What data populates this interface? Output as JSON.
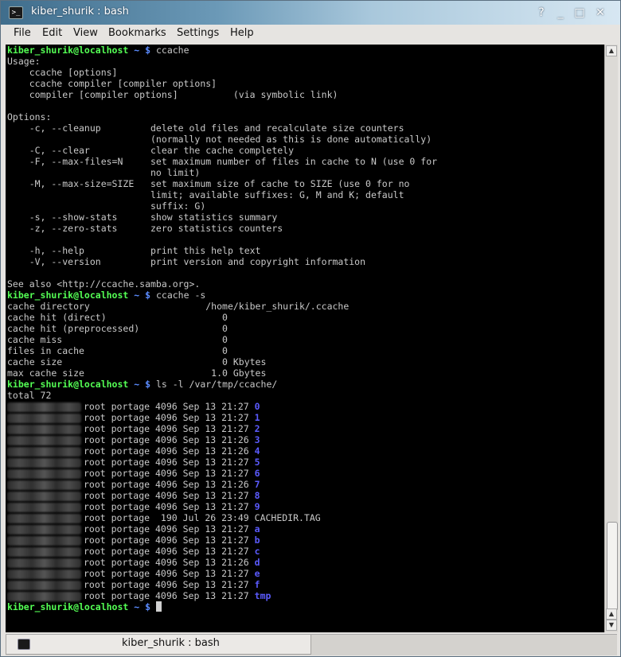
{
  "window": {
    "title": "kiber_shurik : bash"
  },
  "titlebar_buttons": [
    "?",
    "_",
    "□",
    "✕"
  ],
  "menu": [
    "File",
    "Edit",
    "View",
    "Bookmarks",
    "Settings",
    "Help"
  ],
  "prompt": {
    "user": "kiber_shurik@localhost",
    "dir": "~ $"
  },
  "commands": {
    "c1": "ccache",
    "c2": "ccache -s",
    "c3": "ls -l /var/tmp/ccache/"
  },
  "help_lines": [
    "Usage:",
    "    ccache [options]",
    "    ccache compiler [compiler options]",
    "    compiler [compiler options]          (via symbolic link)",
    "",
    "Options:",
    "    -c, --cleanup         delete old files and recalculate size counters",
    "                          (normally not needed as this is done automatically)",
    "    -C, --clear           clear the cache completely",
    "    -F, --max-files=N     set maximum number of files in cache to N (use 0 for",
    "                          no limit)",
    "    -M, --max-size=SIZE   set maximum size of cache to SIZE (use 0 for no",
    "                          limit; available suffixes: G, M and K; default",
    "                          suffix: G)",
    "    -s, --show-stats      show statistics summary",
    "    -z, --zero-stats      zero statistics counters",
    "",
    "    -h, --help            print this help text",
    "    -V, --version         print version and copyright information",
    "",
    "See also <http://ccache.samba.org>."
  ],
  "stats_lines": [
    "cache directory                     /home/kiber_shurik/.ccache",
    "cache hit (direct)                     0",
    "cache hit (preprocessed)               0",
    "cache miss                             0",
    "files in cache                         0",
    "cache size                             0 Kbytes",
    "max cache size                       1.0 Gbytes"
  ],
  "ls_total": "total 72",
  "ls_rows": [
    {
      "meta": "root portage 4096 Sep 13 21:27 ",
      "name": "0",
      "dir": true
    },
    {
      "meta": "root portage 4096 Sep 13 21:27 ",
      "name": "1",
      "dir": true
    },
    {
      "meta": "root portage 4096 Sep 13 21:27 ",
      "name": "2",
      "dir": true
    },
    {
      "meta": "root portage 4096 Sep 13 21:26 ",
      "name": "3",
      "dir": true
    },
    {
      "meta": "root portage 4096 Sep 13 21:26 ",
      "name": "4",
      "dir": true
    },
    {
      "meta": "root portage 4096 Sep 13 21:27 ",
      "name": "5",
      "dir": true
    },
    {
      "meta": "root portage 4096 Sep 13 21:27 ",
      "name": "6",
      "dir": true
    },
    {
      "meta": "root portage 4096 Sep 13 21:26 ",
      "name": "7",
      "dir": true
    },
    {
      "meta": "root portage 4096 Sep 13 21:27 ",
      "name": "8",
      "dir": true
    },
    {
      "meta": "root portage 4096 Sep 13 21:27 ",
      "name": "9",
      "dir": true
    },
    {
      "meta": "root portage  190 Jul 26 23:49 ",
      "name": "CACHEDIR.TAG",
      "dir": false
    },
    {
      "meta": "root portage 4096 Sep 13 21:27 ",
      "name": "a",
      "dir": true
    },
    {
      "meta": "root portage 4096 Sep 13 21:27 ",
      "name": "b",
      "dir": true
    },
    {
      "meta": "root portage 4096 Sep 13 21:27 ",
      "name": "c",
      "dir": true
    },
    {
      "meta": "root portage 4096 Sep 13 21:26 ",
      "name": "d",
      "dir": true
    },
    {
      "meta": "root portage 4096 Sep 13 21:27 ",
      "name": "e",
      "dir": true
    },
    {
      "meta": "root portage 4096 Sep 13 21:27 ",
      "name": "f",
      "dir": true
    },
    {
      "meta": "root portage 4096 Sep 13 21:27 ",
      "name": "tmp",
      "dir": true
    }
  ],
  "tab": {
    "label": "kiber_shurik : bash"
  },
  "colors": {
    "prompt_user": "#54ff54",
    "prompt_dir": "#5b8cff",
    "dir_name": "#5b5bff",
    "text": "#c9c9c9"
  }
}
